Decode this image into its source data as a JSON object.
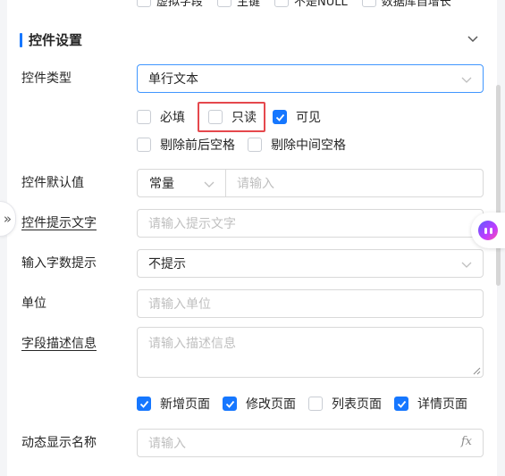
{
  "top_clipped": [
    "虚拟字段",
    "主键",
    "不是NULL",
    "数据库自增长"
  ],
  "section": {
    "title": "控件设置"
  },
  "control_type": {
    "label": "控件类型",
    "value": "单行文本"
  },
  "options": {
    "required": {
      "label": "必填",
      "checked": false
    },
    "readonly": {
      "label": "只读",
      "checked": false
    },
    "visible": {
      "label": "可见",
      "checked": true
    },
    "trim_ends": {
      "label": "剔除前后空格",
      "checked": false
    },
    "trim_middle": {
      "label": "剔除中间空格",
      "checked": false
    }
  },
  "default_value": {
    "label": "控件默认值",
    "mode": "常量",
    "placeholder": "请输入"
  },
  "hint_text": {
    "label": "控件提示文字",
    "placeholder": "请输入提示文字"
  },
  "char_count_hint": {
    "label": "输入字数提示",
    "value": "不提示"
  },
  "unit": {
    "label": "单位",
    "placeholder": "请输入单位"
  },
  "field_desc": {
    "label": "字段描述信息",
    "placeholder": "请输入描述信息"
  },
  "pages": [
    {
      "label": "新增页面",
      "checked": true
    },
    {
      "label": "修改页面",
      "checked": true
    },
    {
      "label": "列表页面",
      "checked": false
    },
    {
      "label": "详情页面",
      "checked": true
    }
  ],
  "dynamic_name": {
    "label": "动态显示名称",
    "placeholder": "请输入",
    "fx": "fx"
  },
  "expander_glyph": "»",
  "colors": {
    "accent": "#1677ff",
    "highlight": "#e5484d"
  }
}
